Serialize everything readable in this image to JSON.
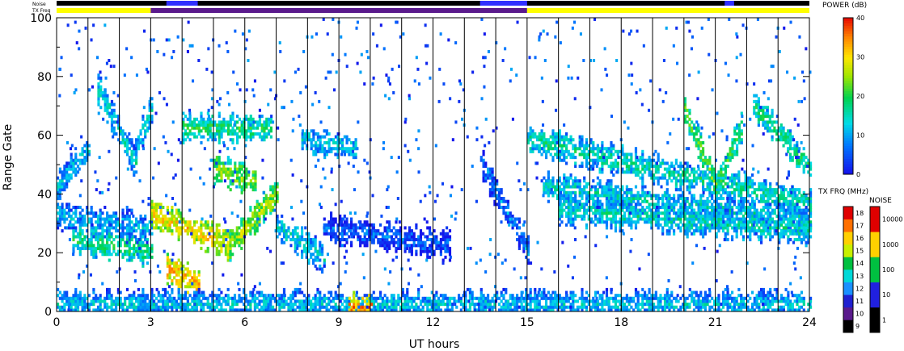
{
  "chart_data": {
    "type": "heatmap",
    "xlabel": "UT hours",
    "ylabel": "Range Gate",
    "xlim": [
      0,
      24
    ],
    "ylim": [
      0,
      100
    ],
    "x_ticks": [
      "0",
      "3",
      "6",
      "9",
      "12",
      "15",
      "18",
      "21",
      "24"
    ],
    "y_ticks": [
      "0",
      "20",
      "40",
      "60",
      "80",
      "100"
    ],
    "top_bars": {
      "noise_label": "Noise",
      "txfreq_label": "TX Freq",
      "txfreq_segments": [
        {
          "from": 0,
          "to": 3,
          "color": "#ffff00"
        },
        {
          "from": 3,
          "to": 15,
          "color": "#5a1a8c"
        },
        {
          "from": 15,
          "to": 24,
          "color": "#ffff00"
        }
      ],
      "noise_blue_segments": [
        {
          "from": 3.5,
          "to": 4.5
        },
        {
          "from": 13.5,
          "to": 15.0
        },
        {
          "from": 21.3,
          "to": 21.6
        }
      ]
    },
    "power_colorbar": {
      "title": "POWER (dB)",
      "ticks": [
        "0",
        "10",
        "20",
        "30",
        "40"
      ],
      "range": [
        0,
        40
      ]
    },
    "txfreq_colorbar": {
      "title": "TX FRQ (MHz)",
      "ticks": [
        "9",
        "10",
        "11",
        "12",
        "13",
        "14",
        "15",
        "16",
        "17",
        "18"
      ]
    },
    "noise_colorbar": {
      "title": "NOISE",
      "ticks": [
        "1",
        "10",
        "100",
        "1000",
        "10000"
      ]
    },
    "features": [
      {
        "name": "band",
        "x0": 0.0,
        "x1": 1.0,
        "y0": 42,
        "y1": 55,
        "p": 12
      },
      {
        "name": "band",
        "x0": 1.3,
        "x1": 2.5,
        "y0": 75,
        "y1": 50,
        "p": 14
      },
      {
        "name": "band",
        "x0": 2.5,
        "x1": 3.0,
        "y0": 55,
        "y1": 68,
        "p": 13
      },
      {
        "name": "band",
        "x0": 0.0,
        "x1": 3.0,
        "y0": 32,
        "y1": 28,
        "p": 11
      },
      {
        "name": "band",
        "x0": 0.5,
        "x1": 3.0,
        "y0": 24,
        "y1": 20,
        "p": 18
      },
      {
        "name": "band",
        "x0": 3.0,
        "x1": 5.5,
        "y0": 33,
        "y1": 22,
        "p": 30
      },
      {
        "name": "band",
        "x0": 5.5,
        "x1": 7.0,
        "y0": 22,
        "y1": 40,
        "p": 25
      },
      {
        "name": "band",
        "x0": 3.5,
        "x1": 4.5,
        "y0": 14,
        "y1": 9,
        "p": 32
      },
      {
        "name": "band",
        "x0": 5.0,
        "x1": 6.3,
        "y0": 48,
        "y1": 44,
        "p": 24
      },
      {
        "name": "band",
        "x0": 4.0,
        "x1": 6.8,
        "y0": 62,
        "y1": 62,
        "p": 18
      },
      {
        "name": "band",
        "x0": 7.0,
        "x1": 8.5,
        "y0": 28,
        "y1": 18,
        "p": 14
      },
      {
        "name": "band",
        "x0": 7.8,
        "x1": 9.5,
        "y0": 58,
        "y1": 55,
        "p": 13
      },
      {
        "name": "band",
        "x0": 8.5,
        "x1": 12.5,
        "y0": 28,
        "y1": 22,
        "p": 6
      },
      {
        "name": "band",
        "x0": 13.5,
        "x1": 15.0,
        "y0": 50,
        "y1": 20,
        "p": 8
      },
      {
        "name": "band",
        "x0": 15.0,
        "x1": 24.0,
        "y0": 58,
        "y1": 36,
        "p": 16
      },
      {
        "name": "band",
        "x0": 15.5,
        "x1": 24.0,
        "y0": 42,
        "y1": 30,
        "p": 14
      },
      {
        "name": "band",
        "x0": 16.0,
        "x1": 24.0,
        "y0": 34,
        "y1": 27,
        "p": 15
      },
      {
        "name": "band",
        "x0": 20.0,
        "x1": 21.0,
        "y0": 68,
        "y1": 42,
        "p": 22
      },
      {
        "name": "band",
        "x0": 21.0,
        "x1": 21.8,
        "y0": 42,
        "y1": 62,
        "p": 20
      },
      {
        "name": "band",
        "x0": 22.2,
        "x1": 24.0,
        "y0": 70,
        "y1": 48,
        "p": 18
      },
      {
        "name": "band",
        "x0": 0.0,
        "x1": 24.0,
        "y0": 2,
        "y1": 2,
        "p": 12
      },
      {
        "name": "band",
        "x0": 9.3,
        "x1": 10.0,
        "y0": 1,
        "y1": 1,
        "p": 34
      }
    ]
  }
}
